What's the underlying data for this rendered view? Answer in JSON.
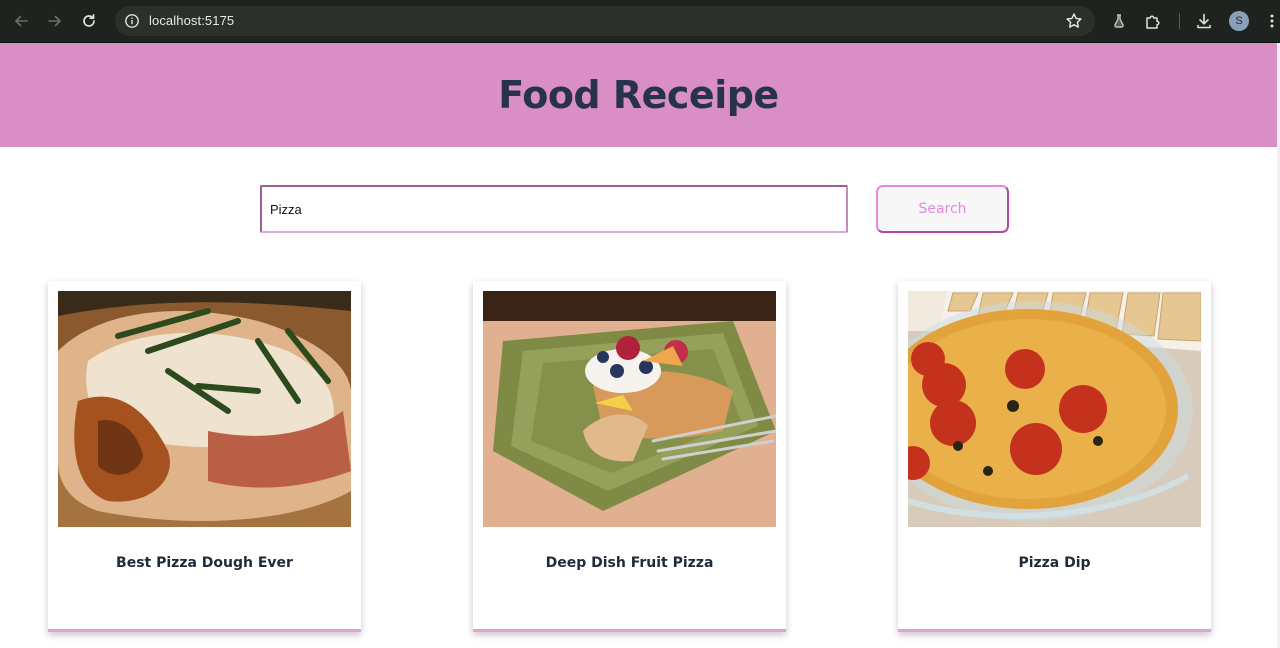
{
  "browser": {
    "url": "localhost:5175",
    "profile_initial": "S",
    "icons": [
      "back-icon",
      "forward-icon",
      "reload-icon",
      "site-info-icon",
      "bookmark-star-icon",
      "download-icon",
      "extensions-icon",
      "labs-icon",
      "menu-icon"
    ]
  },
  "header": {
    "title": "Food Receipe",
    "background_color": "#d98ec5",
    "title_color": "#273349"
  },
  "search": {
    "value": "Pizza",
    "button_label": "Search",
    "accent_color": "#e58ad8"
  },
  "recipes": [
    {
      "title": "Best Pizza Dough Ever"
    },
    {
      "title": "Deep Dish Fruit Pizza"
    },
    {
      "title": "Pizza Dip"
    }
  ]
}
